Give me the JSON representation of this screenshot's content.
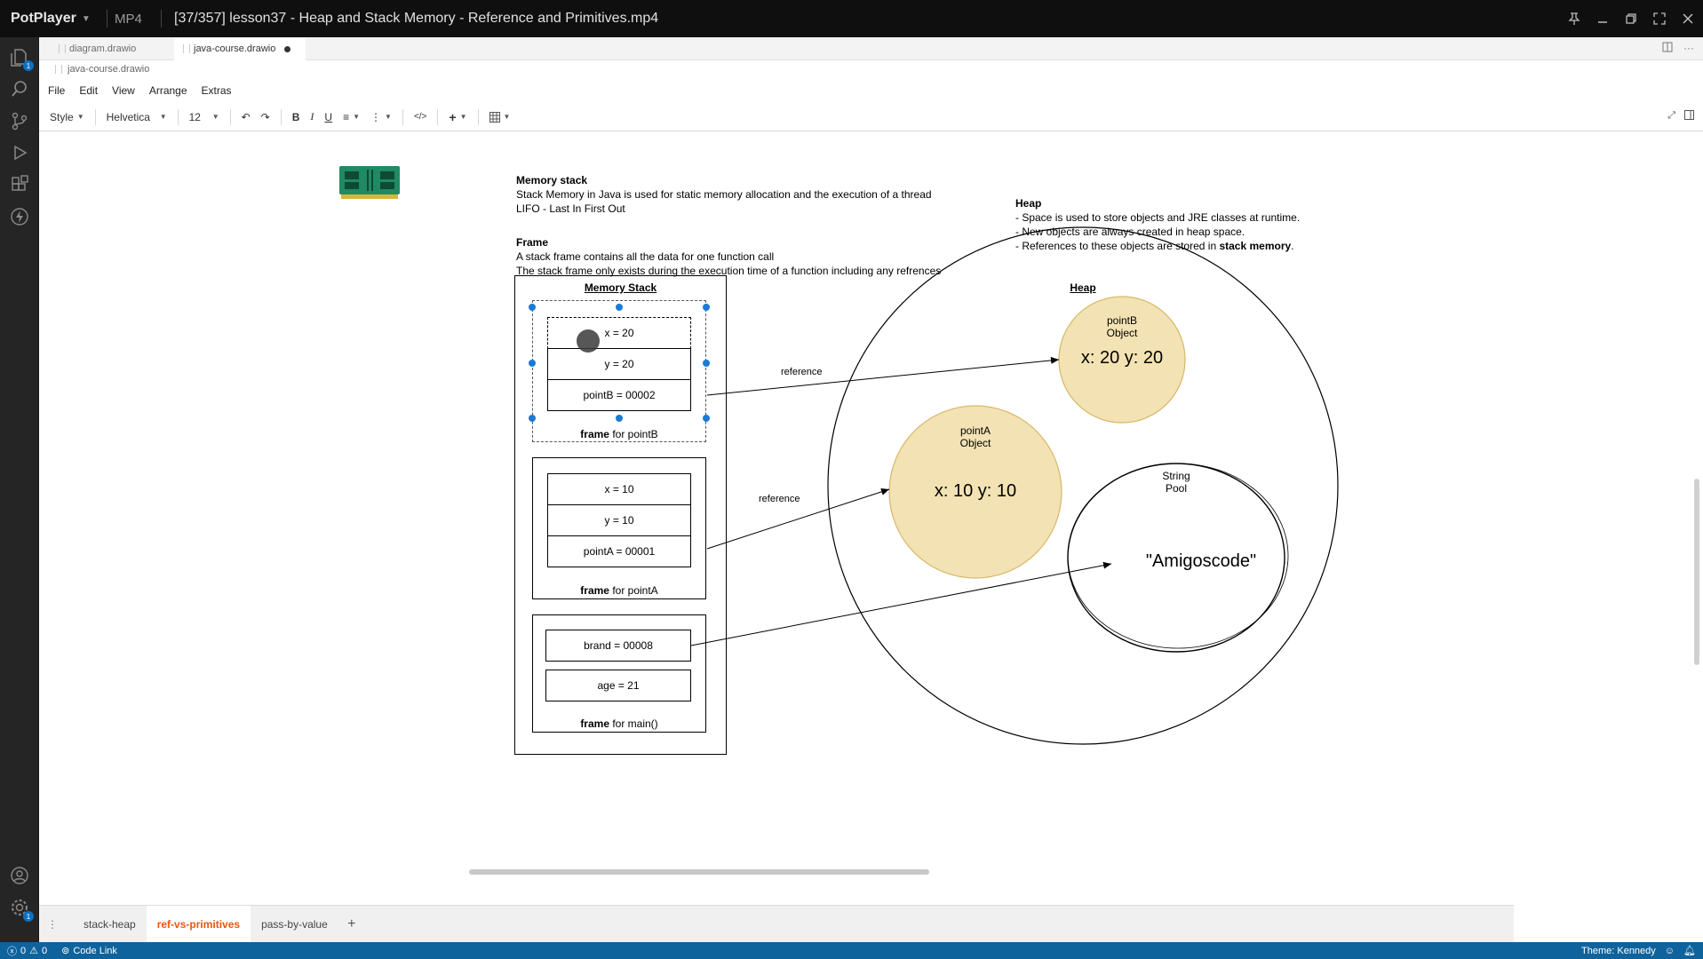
{
  "titlebar": {
    "app_name": "PotPlayer",
    "format": "MP4",
    "title": "[37/357] lesson37 - Heap and Stack Memory - Reference and Primitives.mp4"
  },
  "tabs": [
    {
      "label": "diagram.drawio",
      "active": false,
      "dirty": false
    },
    {
      "label": "java-course.drawio",
      "active": true,
      "dirty": true
    }
  ],
  "breadcrumb": "java-course.drawio",
  "menu": [
    "File",
    "Edit",
    "View",
    "Arrange",
    "Extras"
  ],
  "toolbar": {
    "style_label": "Style",
    "font": "Helvetica",
    "font_size": "12"
  },
  "canvas": {
    "memory_stack_text": {
      "heading": "Memory stack",
      "lines": [
        "Stack Memory in Java is used for static memory allocation and the execution of a thread",
        "LIFO - Last In First Out"
      ]
    },
    "frame_text": {
      "heading": "Frame",
      "lines": [
        "A stack frame contains all the data for one function call",
        "The stack frame only exists during the execution time of a function including any refrences"
      ]
    },
    "heap_text": {
      "heading": "Heap",
      "lines": [
        "- Space is used to store objects and JRE classes at runtime.",
        "- New objects are always created in heap space."
      ],
      "last_line_prefix": "- References to these objects are stored in ",
      "last_line_bold": "stack memory",
      "last_line_suffix": "."
    },
    "memory_stack_title": "Memory Stack",
    "heap_title": "Heap",
    "frames": [
      {
        "cells": [
          "x = 20",
          "y = 20",
          "pointB = 00002"
        ],
        "label_bold": "frame",
        "label_rest": " for pointB",
        "selected": true
      },
      {
        "cells": [
          "x = 10",
          "y = 10",
          "pointA = 00001"
        ],
        "label_bold": "frame",
        "label_rest": " for pointA",
        "selected": false
      },
      {
        "cells": [
          "brand = 00008",
          "age = 21"
        ],
        "label_bold": "frame",
        "label_rest": " for main()",
        "selected": false
      }
    ],
    "reference_label_1": "reference",
    "reference_label_2": "reference",
    "pointB": {
      "label_1": "pointB",
      "label_2": "Object",
      "value": "x: 20 y: 20"
    },
    "pointA": {
      "label_1": "pointA",
      "label_2": "Object",
      "value": "x: 10 y: 10"
    },
    "string_pool": {
      "label_1": "String",
      "label_2": "Pool",
      "value": "\"Amigoscode\""
    },
    "colors": {
      "object_fill": "#f3e2b3",
      "object_stroke": "#d5b969",
      "handle": "#1a7bd4",
      "ram_green": "#1f8a63"
    }
  },
  "pages": [
    {
      "label": "stack-heap",
      "active": false
    },
    {
      "label": "ref-vs-primitives",
      "active": true
    },
    {
      "label": "pass-by-value",
      "active": false
    }
  ],
  "statusbar": {
    "errors": "0",
    "warnings": "0",
    "code_link": "Code Link",
    "theme": "Theme: Kennedy"
  }
}
